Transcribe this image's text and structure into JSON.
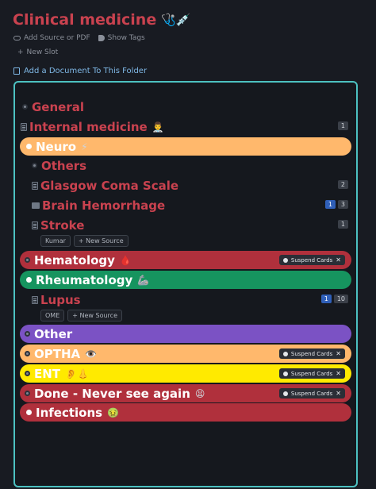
{
  "title": "Clinical medicine",
  "title_emoji": "🩺💉",
  "actions": {
    "add_source": "Add Source or PDF",
    "show_tags": "Show Tags"
  },
  "new_slot": "New Slot",
  "add_document": "Add a Document To This Folder",
  "suspend_label": "Suspend Cards",
  "close_label": "✕",
  "new_source_label": "New Source",
  "colors": {
    "accent": "#c9424f",
    "panel_border": "#4cc1c1",
    "neuro": "#ffb86c",
    "hematology": "#b0303c",
    "rheumatology": "#16945f",
    "other": "#7b52c4",
    "optha": "#ffb86c",
    "ent": "#ffea00",
    "done": "#b0303c",
    "infections": "#b0303c"
  },
  "items": {
    "general": {
      "label": "General"
    },
    "internal": {
      "label": "Internal medicine",
      "emoji": "👨‍⚕️",
      "badge": "1"
    },
    "neuro": {
      "label": "Neuro",
      "emoji": "⚡"
    },
    "others": {
      "label": "Others"
    },
    "gcs": {
      "label": "Glasgow Coma Scale",
      "badge": "2"
    },
    "brain": {
      "label": "Brain Hemorrhage",
      "badge_blue": "1",
      "badge": "3"
    },
    "stroke": {
      "label": "Stroke",
      "badge": "1",
      "chip": "Kumar"
    },
    "hematology": {
      "label": "Hematology",
      "emoji": "🩸"
    },
    "rheumatology": {
      "label": "Rheumatology",
      "emoji": "🦾"
    },
    "lupus": {
      "label": "Lupus",
      "badge_blue": "1",
      "badge": "10",
      "chip": "OME"
    },
    "other": {
      "label": "Other"
    },
    "optha": {
      "label": "OPTHA",
      "emoji": "👁️"
    },
    "ent": {
      "label": "ENT",
      "emoji": "👂👃"
    },
    "done": {
      "label": "Done - Never see again",
      "emoji": "😫"
    },
    "infections": {
      "label": "Infections",
      "emoji": "🤢"
    }
  }
}
